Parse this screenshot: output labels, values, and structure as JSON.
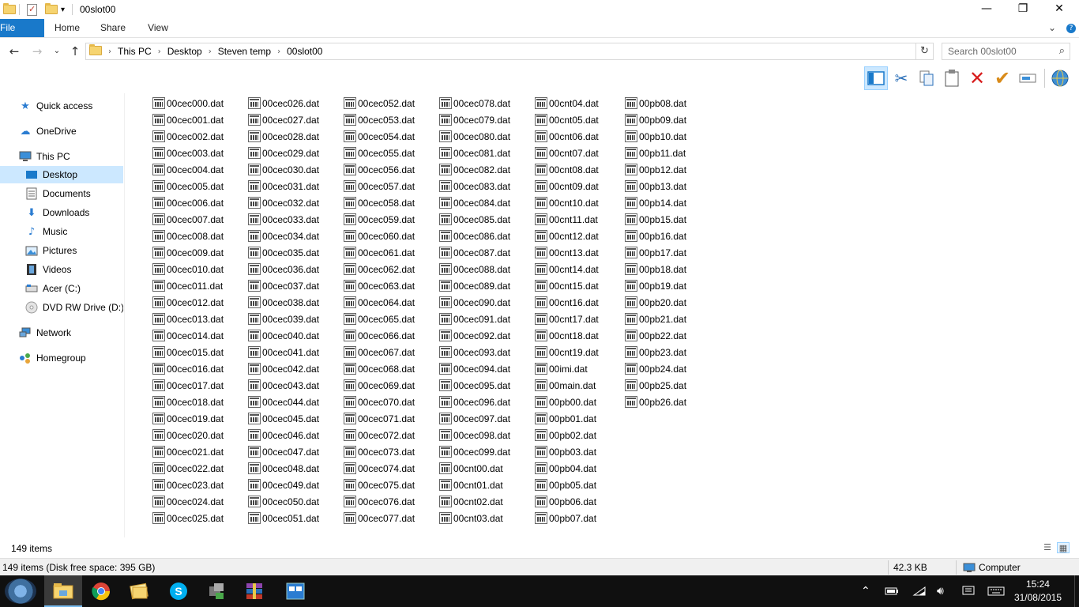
{
  "window": {
    "title": "00slot00",
    "controls": {
      "minimize": "—",
      "maximize": "❐",
      "close": "✕"
    }
  },
  "ribbon": {
    "tabs": [
      "File",
      "Home",
      "Share",
      "View"
    ],
    "expand_icon": "chevron-down-icon",
    "help_icon": "help-icon"
  },
  "address": {
    "breadcrumbs": [
      "This PC",
      "Desktop",
      "Steven temp",
      "00slot00"
    ],
    "search_placeholder": "Search 00slot00"
  },
  "toolbar": {
    "icons": [
      "layout-pane-icon",
      "cut-icon",
      "copy-icon",
      "paste-icon",
      "delete-icon",
      "checkmark-icon",
      "rename-icon",
      "globe-icon"
    ]
  },
  "nav": {
    "items": [
      {
        "label": "Quick access",
        "icon": "star-icon"
      },
      {
        "label": "OneDrive",
        "icon": "cloud-icon"
      },
      {
        "label": "This PC",
        "icon": "computer-icon"
      },
      {
        "label": "Desktop",
        "icon": "desktop-icon",
        "selected": true
      },
      {
        "label": "Documents",
        "icon": "documents-icon"
      },
      {
        "label": "Downloads",
        "icon": "download-icon"
      },
      {
        "label": "Music",
        "icon": "music-icon"
      },
      {
        "label": "Pictures",
        "icon": "pictures-icon"
      },
      {
        "label": "Videos",
        "icon": "videos-icon"
      },
      {
        "label": "Acer (C:)",
        "icon": "drive-icon"
      },
      {
        "label": "DVD RW Drive (D:) D",
        "icon": "dvd-icon"
      },
      {
        "label": "Network",
        "icon": "network-icon"
      },
      {
        "label": "Homegroup",
        "icon": "homegroup-icon"
      }
    ]
  },
  "files": {
    "columns": [
      [
        "00cec000.dat",
        "00cec001.dat",
        "00cec002.dat",
        "00cec003.dat",
        "00cec004.dat",
        "00cec005.dat",
        "00cec006.dat",
        "00cec007.dat",
        "00cec008.dat",
        "00cec009.dat",
        "00cec010.dat",
        "00cec011.dat",
        "00cec012.dat",
        "00cec013.dat",
        "00cec014.dat",
        "00cec015.dat",
        "00cec016.dat",
        "00cec017.dat",
        "00cec018.dat",
        "00cec019.dat",
        "00cec020.dat",
        "00cec021.dat",
        "00cec022.dat",
        "00cec023.dat",
        "00cec024.dat",
        "00cec025.dat"
      ],
      [
        "00cec026.dat",
        "00cec027.dat",
        "00cec028.dat",
        "00cec029.dat",
        "00cec030.dat",
        "00cec031.dat",
        "00cec032.dat",
        "00cec033.dat",
        "00cec034.dat",
        "00cec035.dat",
        "00cec036.dat",
        "00cec037.dat",
        "00cec038.dat",
        "00cec039.dat",
        "00cec040.dat",
        "00cec041.dat",
        "00cec042.dat",
        "00cec043.dat",
        "00cec044.dat",
        "00cec045.dat",
        "00cec046.dat",
        "00cec047.dat",
        "00cec048.dat",
        "00cec049.dat",
        "00cec050.dat",
        "00cec051.dat"
      ],
      [
        "00cec052.dat",
        "00cec053.dat",
        "00cec054.dat",
        "00cec055.dat",
        "00cec056.dat",
        "00cec057.dat",
        "00cec058.dat",
        "00cec059.dat",
        "00cec060.dat",
        "00cec061.dat",
        "00cec062.dat",
        "00cec063.dat",
        "00cec064.dat",
        "00cec065.dat",
        "00cec066.dat",
        "00cec067.dat",
        "00cec068.dat",
        "00cec069.dat",
        "00cec070.dat",
        "00cec071.dat",
        "00cec072.dat",
        "00cec073.dat",
        "00cec074.dat",
        "00cec075.dat",
        "00cec076.dat",
        "00cec077.dat"
      ],
      [
        "00cec078.dat",
        "00cec079.dat",
        "00cec080.dat",
        "00cec081.dat",
        "00cec082.dat",
        "00cec083.dat",
        "00cec084.dat",
        "00cec085.dat",
        "00cec086.dat",
        "00cec087.dat",
        "00cec088.dat",
        "00cec089.dat",
        "00cec090.dat",
        "00cec091.dat",
        "00cec092.dat",
        "00cec093.dat",
        "00cec094.dat",
        "00cec095.dat",
        "00cec096.dat",
        "00cec097.dat",
        "00cec098.dat",
        "00cec099.dat",
        "00cnt00.dat",
        "00cnt01.dat",
        "00cnt02.dat",
        "00cnt03.dat"
      ],
      [
        "00cnt04.dat",
        "00cnt05.dat",
        "00cnt06.dat",
        "00cnt07.dat",
        "00cnt08.dat",
        "00cnt09.dat",
        "00cnt10.dat",
        "00cnt11.dat",
        "00cnt12.dat",
        "00cnt13.dat",
        "00cnt14.dat",
        "00cnt15.dat",
        "00cnt16.dat",
        "00cnt17.dat",
        "00cnt18.dat",
        "00cnt19.dat",
        "00imi.dat",
        "00main.dat",
        "00pb00.dat",
        "00pb01.dat",
        "00pb02.dat",
        "00pb03.dat",
        "00pb04.dat",
        "00pb05.dat",
        "00pb06.dat",
        "00pb07.dat"
      ],
      [
        "00pb08.dat",
        "00pb09.dat",
        "00pb10.dat",
        "00pb11.dat",
        "00pb12.dat",
        "00pb13.dat",
        "00pb14.dat",
        "00pb15.dat",
        "00pb16.dat",
        "00pb17.dat",
        "00pb18.dat",
        "00pb19.dat",
        "00pb20.dat",
        "00pb21.dat",
        "00pb22.dat",
        "00pb23.dat",
        "00pb24.dat",
        "00pb25.dat",
        "00pb26.dat"
      ]
    ]
  },
  "status": {
    "item_count": "149 items",
    "detail": "149 items (Disk free space: 395 GB)",
    "size": "42.3 KB",
    "location": "Computer"
  },
  "taskbar": {
    "apps": [
      "file-explorer-icon",
      "chrome-icon",
      "folder-app-icon",
      "skype-icon",
      "app-icon",
      "winrar-icon",
      "app2-icon"
    ],
    "tray_icons": [
      "chevron-up-icon",
      "battery-icon",
      "wifi-icon",
      "volume-icon",
      "notification-icon",
      "keyboard-icon"
    ],
    "time": "15:24",
    "date": "31/08/2015"
  }
}
